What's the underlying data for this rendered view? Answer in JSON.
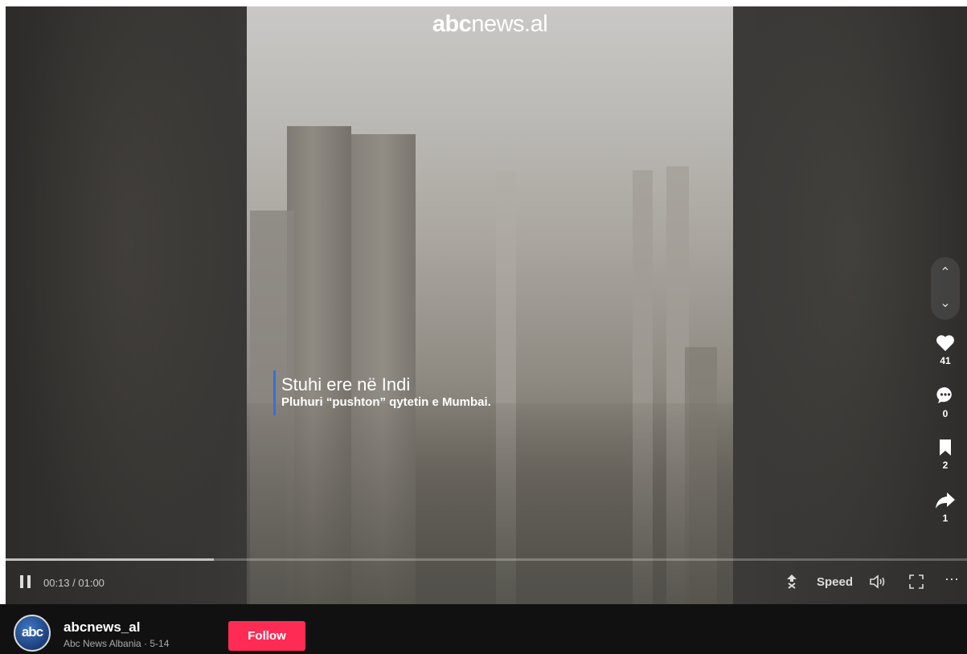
{
  "video": {
    "watermark_bold": "abc",
    "watermark_rest": "news.al",
    "caption_line1": "Stuhi ere në Indi",
    "caption_line2": "Pluhuri “pushton” qytetin e Mumbai.",
    "progress": 0.2167
  },
  "actions": {
    "likes": "41",
    "comments": "0",
    "saves": "2",
    "shares": "1"
  },
  "controls": {
    "time": "00:13 / 01:00",
    "speed_label": "Speed"
  },
  "author": {
    "avatar_text": "abc",
    "username": "abcnews_al",
    "subtitle": "Abc News Albania · 5-14",
    "follow_label": "Follow"
  },
  "colors": {
    "follow": "#fe2c55",
    "caption_bar": "#3b6fd1"
  }
}
